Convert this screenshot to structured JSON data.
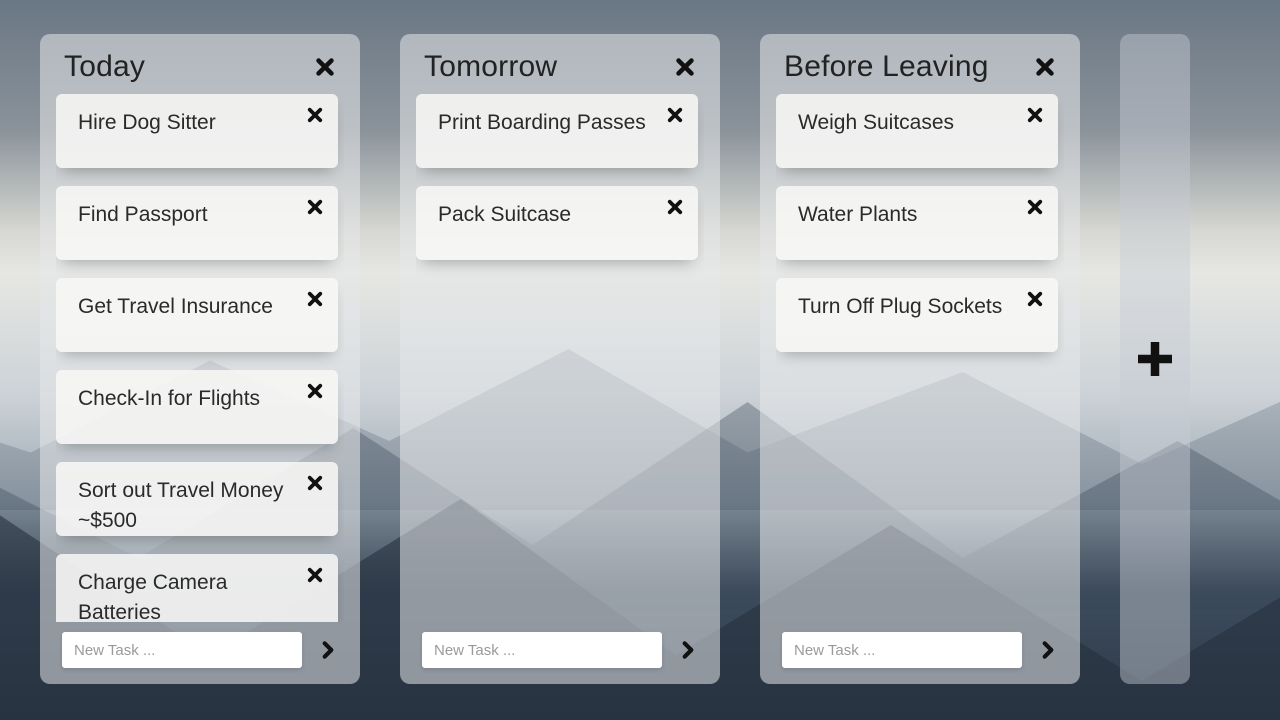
{
  "new_task_placeholder": "New Task ...",
  "columns": [
    {
      "title": "Today",
      "tasks": [
        "Hire Dog Sitter",
        "Find Passport",
        "Get Travel Insurance",
        "Check-In for Flights",
        "Sort out Travel Money ~$500",
        "Charge Camera Batteries"
      ]
    },
    {
      "title": "Tomorrow",
      "tasks": [
        "Print Boarding Passes",
        "Pack Suitcase"
      ]
    },
    {
      "title": "Before Leaving",
      "tasks": [
        "Weigh Suitcases",
        "Water Plants",
        "Turn Off Plug Sockets"
      ]
    }
  ]
}
